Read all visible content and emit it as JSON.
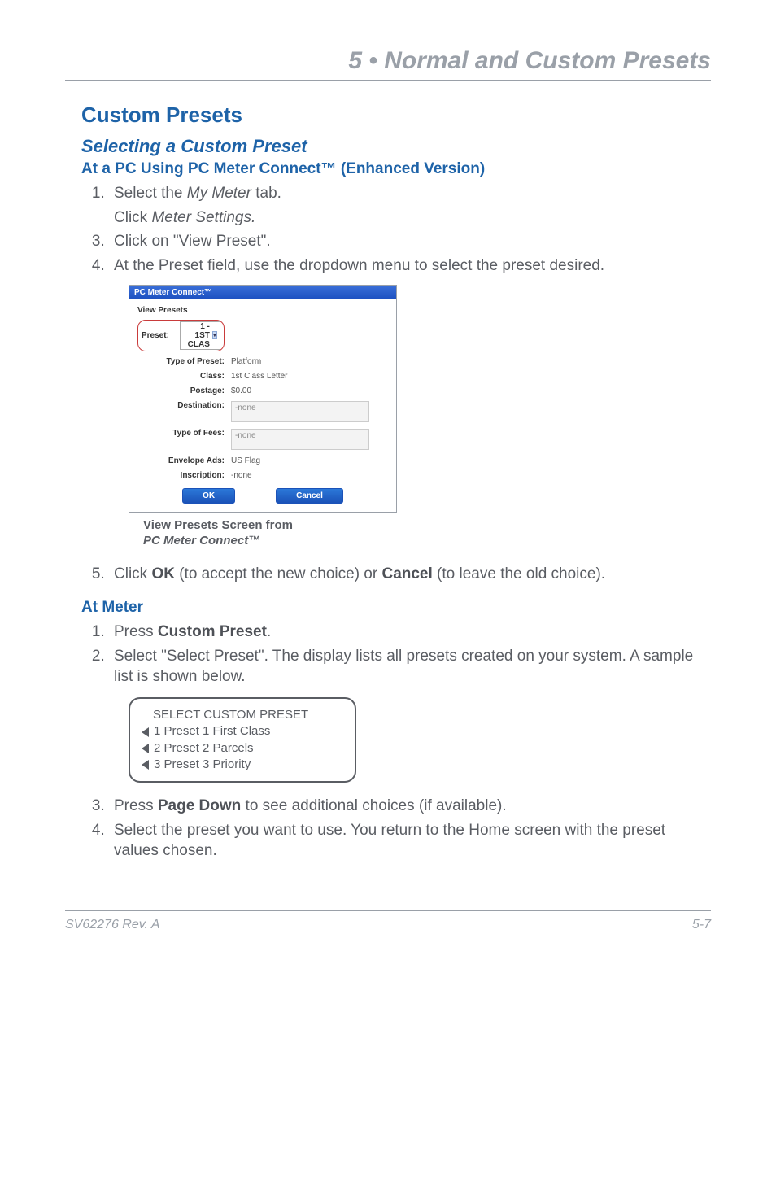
{
  "chapter": {
    "title": "5 • Normal and Custom Presets"
  },
  "h1": "Custom Presets",
  "h2": "Selecting a Custom Preset",
  "pc_section": {
    "heading": "At a PC Using PC Meter Connect™ (Enhanced Version)",
    "steps": {
      "s1_a": "Select the ",
      "s1_b": "My Meter",
      "s1_c": " tab.",
      "s2_a": "Click ",
      "s2_b": "Meter Settings.",
      "s3": "Click on \"View Preset\".",
      "s4": "At the Preset field, use the dropdown menu to select the preset desired.",
      "s5_a": "Click ",
      "s5_b": "OK",
      "s5_c": " (to accept the new choice) or ",
      "s5_d": "Cancel",
      "s5_e": " (to leave the old choice)."
    }
  },
  "screenshot": {
    "titlebar": "PC Meter Connect™",
    "panel_title": "View Presets",
    "labels": {
      "preset": "Preset:",
      "preset_value": "1 - 1ST CLAS",
      "type_of_preset": "Type of Preset:",
      "type_of_preset_value": "Platform",
      "class_": "Class:",
      "class_value": "1st Class Letter",
      "postage": "Postage:",
      "postage_value": "$0.00",
      "destination": "Destination:",
      "destination_value": "-none",
      "type_of_fees": "Type of Fees:",
      "type_of_fees_value": "-none",
      "envelope_ads": "Envelope Ads:",
      "envelope_ads_value": "US Flag",
      "inscription": "Inscription:",
      "inscription_value": "-none"
    },
    "buttons": {
      "ok": "OK",
      "cancel": "Cancel"
    }
  },
  "caption": {
    "line1": "View Presets Screen from",
    "line2": "PC Meter Connect™"
  },
  "meter_section": {
    "heading": "At Meter",
    "steps": {
      "s1_a": "Press ",
      "s1_b": "Custom Preset",
      "s1_c": ".",
      "s2": "Select \"Select Preset\". The display lists all presets created on your system. A sample list is shown below.",
      "s3_a": "Press ",
      "s3_b": "Page Down",
      "s3_c": " to see additional choices (if available).",
      "s4": "Select the preset you want to use. You return to the Home screen  with the preset values chosen."
    }
  },
  "lcd": {
    "title": "SELECT CUSTOM PRESET",
    "row1": "1 Preset 1 First Class",
    "row2": "2 Preset 2 Parcels",
    "row3": "3 Preset 3 Priority"
  },
  "footer": {
    "left": "SV62276 Rev. A",
    "right": "5-7"
  }
}
